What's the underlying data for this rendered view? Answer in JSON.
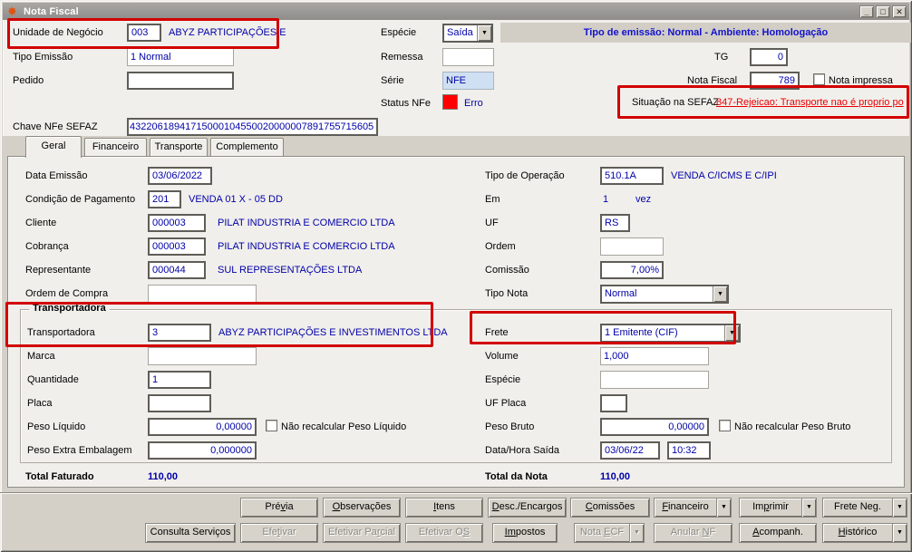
{
  "colors": {
    "gray_bg": "#d4d0c8",
    "panel_bg": "#f1efeb",
    "banner_bg": "#d2cec6",
    "banner_blue": "#1212cc",
    "value_navy": "#0000a8",
    "link_red": "#e80000",
    "status_error_red": "#ff0000",
    "annotation_red": "#d20000",
    "serie_bg": "#cfe0f2"
  },
  "icons": {
    "app": "✸",
    "minimize": "_",
    "maximize": "□",
    "close": "✕",
    "dropdown": "▼"
  },
  "title_bar": {
    "title": "Nota Fiscal"
  },
  "header": {
    "unidade_label": "Unidade de Negócio",
    "unidade_code": "003",
    "unidade_name": "ABYZ PARTICIPAÇÕES E",
    "especie_label": "Espécie",
    "especie_value": "Saída",
    "banner": "Tipo de emissão: Normal - Ambiente: Homologação",
    "tipo_emissao_label": "Tipo Emissão",
    "tipo_emissao_value": "1 Normal",
    "remessa_label": "Remessa",
    "remessa_value": "",
    "tg_label": "TG",
    "tg_value": "0",
    "pedido_label": "Pedido",
    "pedido_value": "",
    "serie_label": "Série",
    "serie_value": "NFE",
    "nota_fiscal_label": "Nota Fiscal",
    "nota_fiscal_value": "789",
    "nota_impressa_label": "Nota impressa",
    "nota_impressa_checked": false,
    "status_label": "Status NFe",
    "status_value": "Erro",
    "sefaz_label": "Situação na SEFAZ",
    "sefaz_link": "847-Rejeicao: Transporte nao é proprio po",
    "chave_label": "Chave NFe SEFAZ",
    "chave_value": "43220618941715000104550020000007891755715605"
  },
  "tabs": {
    "geral": "Geral",
    "financeiro": "Financeiro",
    "transporte": "Transporte",
    "complemento": "Complemento"
  },
  "geral": {
    "data_emissao_label": "Data Emissão",
    "data_emissao": "03/06/2022",
    "cond_pag_label": "Condição de Pagamento",
    "cond_pag_code": "201",
    "cond_pag_desc": "VENDA 01 X - 05 DD",
    "cliente_label": "Cliente",
    "cliente_code": "000003",
    "cliente_desc": "PILAT INDUSTRIA E COMERCIO LTDA",
    "cobranca_label": "Cobrança",
    "cobranca_code": "000003",
    "cobranca_desc": "PILAT INDUSTRIA E COMERCIO LTDA",
    "repr_label": "Representante",
    "repr_code": "000044",
    "repr_desc": "SUL REPRESENTAÇÕES LTDA",
    "ordem_compra_label": "Ordem de Compra",
    "ordem_compra_value": "",
    "tipo_op_label": "Tipo de Operação",
    "tipo_op_code": "510.1A",
    "tipo_op_desc": "VENDA C/ICMS E C/IPI",
    "em_label": "Em",
    "em_value": "1",
    "em_unit": "vez",
    "uf_label": "UF",
    "uf_value": "RS",
    "ordem_label": "Ordem",
    "ordem_value": "",
    "comissao_label": "Comissão",
    "comissao_value": "7,00%",
    "tipo_nota_label": "Tipo Nota",
    "tipo_nota_value": "Normal",
    "group_title": "Transportadora",
    "transp_label": "Transportadora",
    "transp_code": "3",
    "transp_desc": "ABYZ PARTICIPAÇÕES E INVESTIMENTOS LTDA",
    "frete_label": "Frete",
    "frete_value": "1 Emitente (CIF)",
    "marca_label": "Marca",
    "marca_value": "",
    "volume_label": "Volume",
    "volume_value": "1,000",
    "quantidade_label": "Quantidade",
    "quantidade_value": "1",
    "especie_grp_label": "Espécie",
    "especie_grp_value": "",
    "placa_label": "Placa",
    "placa_value": "",
    "uf_placa_label": "UF Placa",
    "uf_placa_value": "",
    "peso_liq_label": "Peso Líquido",
    "peso_liq_value": "0,00000",
    "peso_liq_chk_label": "Não recalcular Peso Líquido",
    "peso_liq_chk_checked": false,
    "peso_bruto_label": "Peso Bruto",
    "peso_bruto_value": "0,00000",
    "peso_bruto_chk_label": "Não recalcular Peso Bruto",
    "peso_bruto_chk_checked": false,
    "peso_extra_label": "Peso Extra Embalagem",
    "peso_extra_value": "0,000000",
    "data_saida_label": "Data/Hora Saída",
    "data_saida_date": "03/06/22",
    "data_saida_time": "10:32",
    "total_faturado_label": "Total Faturado",
    "total_faturado_value": "110,00",
    "total_nota_label": "Total da Nota",
    "total_nota_value": "110,00"
  },
  "buttons": {
    "row1": [
      {
        "name": "previa",
        "pre": "Pré",
        "key": "v",
        "post": "ia"
      },
      {
        "name": "observacoes",
        "pre": "",
        "key": "O",
        "post": "bservações"
      },
      {
        "name": "itens",
        "pre": "",
        "key": "I",
        "post": "tens"
      },
      {
        "name": "desc-encargos",
        "pre": "",
        "key": "D",
        "post": "esc./Encargos"
      },
      {
        "name": "comissoes",
        "pre": "",
        "key": "C",
        "post": "omissões"
      },
      {
        "name": "financeiro",
        "pre": "",
        "key": "F",
        "post": "inanceiro",
        "arrow": true
      },
      {
        "name": "imprimir",
        "pre": "Im",
        "key": "p",
        "post": "rimir",
        "arrow": true
      },
      {
        "name": "frete-neg",
        "pre": "Frete Ne",
        "key": "g",
        "post": ".",
        "arrow": true
      }
    ],
    "row2": [
      {
        "name": "consulta-servicos",
        "pre": "Consulta Serviços",
        "key": "",
        "post": ""
      },
      {
        "name": "efetivar",
        "pre": "Efe",
        "key": "t",
        "post": "ivar",
        "disabled": true
      },
      {
        "name": "efetivar-parcial",
        "pre": "Efetivar Pa",
        "key": "r",
        "post": "cial",
        "disabled": true
      },
      {
        "name": "efetivar-os",
        "pre": "Efetivar O",
        "key": "S",
        "post": "",
        "disabled": true
      },
      {
        "name": "impostos",
        "pre": "",
        "key": "Im",
        "post": "postos"
      },
      {
        "name": "nota-ecf",
        "pre": "Nota ",
        "key": "E",
        "post": "CF",
        "disabled": true,
        "arrow": true
      },
      {
        "name": "anular-nf",
        "pre": "Anular ",
        "key": "N",
        "post": "F",
        "disabled": true
      },
      {
        "name": "acompanh",
        "pre": "",
        "key": "A",
        "post": "companh."
      },
      {
        "name": "historico",
        "pre": "",
        "key": "H",
        "post": "istórico",
        "arrow": true
      }
    ]
  }
}
